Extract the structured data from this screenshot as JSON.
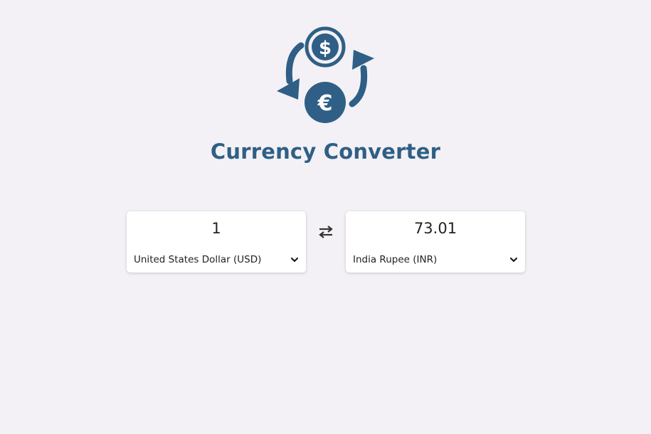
{
  "app": {
    "title": "Currency Converter",
    "accent_color": "#2f5f86",
    "background_color": "#f3f1f5"
  },
  "logo": {
    "icon": "currency-exchange-icon",
    "symbols": [
      "$",
      "€"
    ]
  },
  "converter": {
    "from": {
      "amount": "1",
      "currency": "United States Dollar (USD)"
    },
    "to": {
      "amount": "73.01",
      "currency": "India Rupee (INR)"
    },
    "swap_icon": "swap-arrows-icon",
    "dropdown_icon": "chevron-down-icon"
  }
}
